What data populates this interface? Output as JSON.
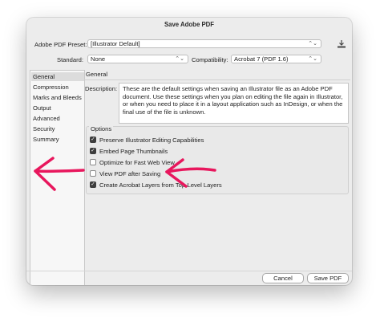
{
  "window": {
    "title": "Save Adobe PDF"
  },
  "preset": {
    "label": "Adobe PDF Preset:",
    "value": "[Illustrator Default]"
  },
  "standard": {
    "label": "Standard:",
    "value": "None"
  },
  "compatibility": {
    "label": "Compatibility:",
    "value": "Acrobat 7 (PDF 1.6)"
  },
  "sidebar": {
    "items": [
      {
        "label": "General",
        "selected": true
      },
      {
        "label": "Compression"
      },
      {
        "label": "Marks and Bleeds"
      },
      {
        "label": "Output"
      },
      {
        "label": "Advanced"
      },
      {
        "label": "Security"
      },
      {
        "label": "Summary"
      }
    ]
  },
  "panel": {
    "title": "General",
    "description_label": "Description:",
    "description": "These are the default settings when saving an Illustrator file as an Adobe PDF document. Use these settings when you plan on editing the file again in Illustrator, or when you need to place it in a layout application such as InDesign, or when the final use of the file is unknown."
  },
  "options": {
    "title": "Options",
    "items": [
      {
        "label": "Preserve Illustrator Editing Capabilities",
        "checked": true
      },
      {
        "label": "Embed Page Thumbnails",
        "checked": true
      },
      {
        "label": "Optimize for Fast Web View",
        "checked": false
      },
      {
        "label": "View PDF after Saving",
        "checked": false
      },
      {
        "label": "Create Acrobat Layers from Top-Level Layers",
        "checked": true
      }
    ]
  },
  "buttons": {
    "cancel": "Cancel",
    "save": "Save PDF"
  },
  "colors": {
    "annotation_arrow": "#e8175d",
    "window_bg": "#ececec"
  },
  "icons": {
    "preset_action": "save-preset-icon",
    "dropdown": "chevron-updown-icon"
  }
}
